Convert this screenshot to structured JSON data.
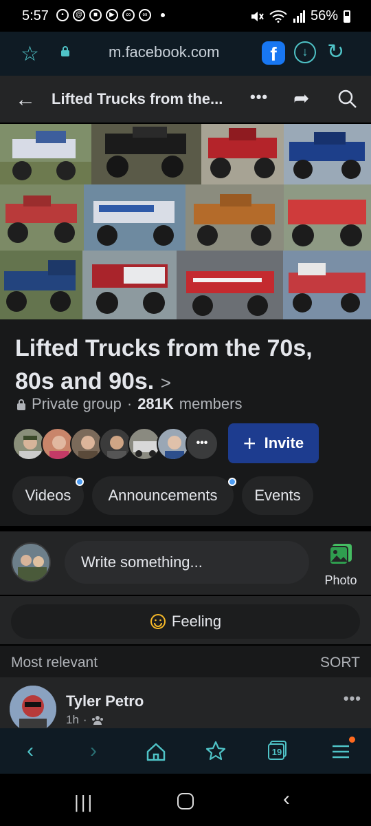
{
  "status_bar": {
    "time": "5:57",
    "battery": "56%"
  },
  "browser": {
    "url": "m.facebook.com",
    "tabs_count": "19"
  },
  "header": {
    "title": "Lifted Trucks from the..."
  },
  "group": {
    "name": "Lifted Trucks from the 70s, 80s and 90s.",
    "chevron": ">",
    "privacy": "Private group",
    "member_count": "281K",
    "members_label": "members",
    "invite_label": "Invite"
  },
  "chips": [
    {
      "label": "Videos"
    },
    {
      "label": "Announcements"
    },
    {
      "label": "Events"
    }
  ],
  "composer": {
    "placeholder": "Write something...",
    "photo_label": "Photo",
    "feeling_label": "Feeling"
  },
  "feed": {
    "filter": "Most relevant",
    "sort": "SORT"
  },
  "post": {
    "author": "Tyler Petro",
    "time": "1h"
  },
  "colors": {
    "accent": "#4fc3c7",
    "fb_blue": "#1877f2",
    "invite_bg": "#1d3c8f",
    "badge": "#4d9cf2"
  }
}
